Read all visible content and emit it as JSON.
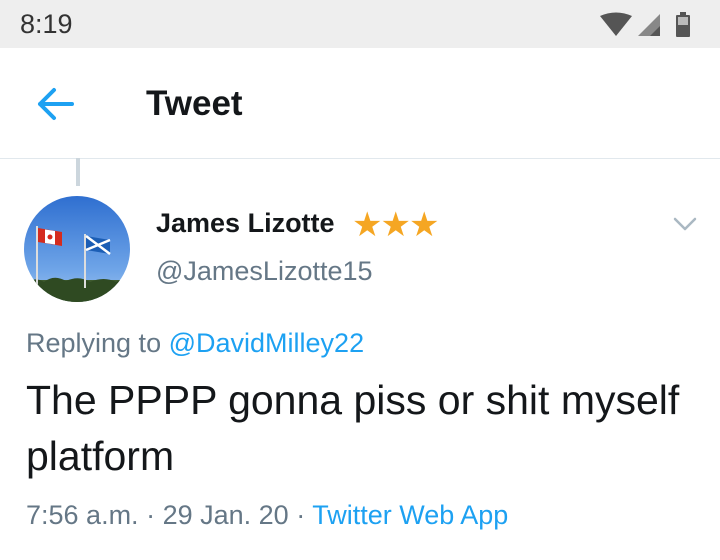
{
  "status_bar": {
    "time": "8:19",
    "icons": [
      "wifi-icon",
      "cell-signal-icon",
      "battery-icon"
    ]
  },
  "header": {
    "back_icon": "arrow-left-icon",
    "title": "Tweet"
  },
  "tweet": {
    "author": {
      "name": "James Lizotte",
      "stars": "★★★",
      "handle": "@JamesLizotte15",
      "avatar": "avatar-flags-image"
    },
    "replying_prefix": "Replying to",
    "replying_to": "@DavidMilley22",
    "text": "The PPPP gonna piss or shit myself platform",
    "time": "7:56 a.m.",
    "sep1": "·",
    "date": "29 Jan. 20",
    "sep2": "·",
    "source": "Twitter Web App"
  },
  "colors": {
    "accent": "#1da1f2",
    "star": "#f5a623",
    "secondary_text": "#657786",
    "status_bar_bg": "#eeeeee"
  }
}
